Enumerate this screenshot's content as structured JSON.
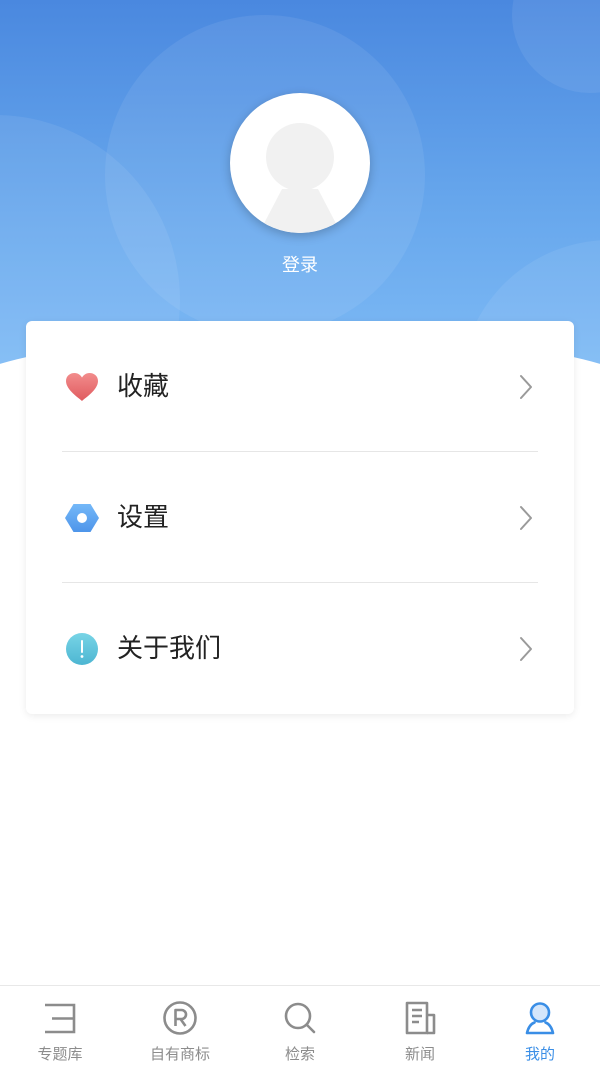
{
  "profile": {
    "avatar_icon": "default-avatar-icon",
    "login_label": "登录"
  },
  "menu": {
    "items": [
      {
        "label": "收藏",
        "icon": "heart-icon"
      },
      {
        "label": "设置",
        "icon": "hexagon-settings-icon"
      },
      {
        "label": "关于我们",
        "icon": "info-icon"
      }
    ]
  },
  "tabbar": {
    "items": [
      {
        "label": "专题库",
        "icon": "topic-library-icon",
        "active": false
      },
      {
        "label": "自有商标",
        "icon": "registered-trademark-icon",
        "active": false
      },
      {
        "label": "检索",
        "icon": "search-icon",
        "active": false
      },
      {
        "label": "新闻",
        "icon": "news-icon",
        "active": false
      },
      {
        "label": "我的",
        "icon": "profile-icon",
        "active": true
      }
    ]
  },
  "colors": {
    "header_top": "#4a88df",
    "header_bottom": "#82bef7",
    "accent": "#3a8ee6",
    "heart": "#e8686a",
    "settings": "#5ea6f2",
    "info": "#5ec6dc",
    "tab_inactive": "#8c8c8c",
    "text": "#222222"
  }
}
